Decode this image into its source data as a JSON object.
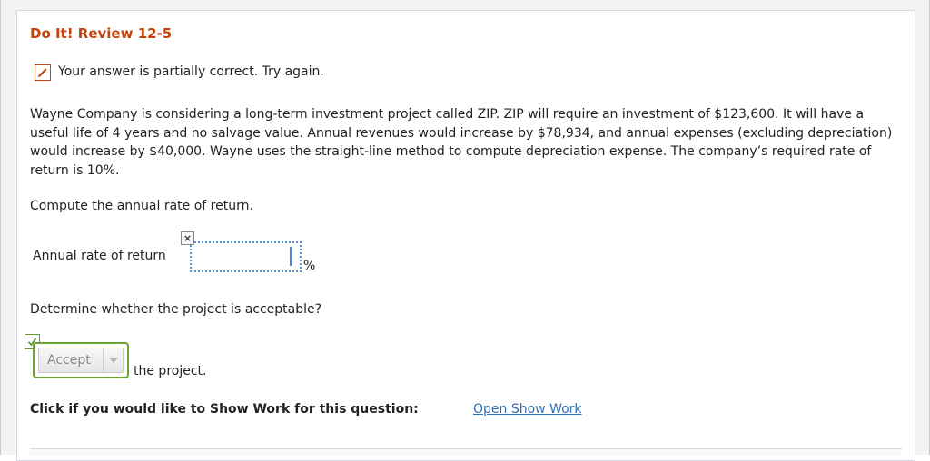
{
  "header": {
    "title": "Do It! Review 12-5"
  },
  "status": {
    "message": "Your answer is partially correct.  Try again.",
    "icon": "pencil-icon",
    "color": "#c0440c"
  },
  "problem": {
    "text": "Wayne Company is considering a long-term investment project called ZIP. ZIP will require an investment of $123,600. It will have a useful life of 4 years and no salvage value. Annual revenues would increase by $78,934, and annual expenses (excluding depreciation) would increase by $40,000. Wayne uses the straight-line method to compute depreciation expense. The company’s required rate of return is 10%."
  },
  "question1": {
    "prompt": "Compute the annual rate of return.",
    "field_label": "Annual rate of return",
    "value": "",
    "unit": "%",
    "mark": "×"
  },
  "question2": {
    "prompt": "Determine whether the project is acceptable?",
    "selected": "Accept",
    "suffix": "the project.",
    "accent": "#6aa531"
  },
  "show_work": {
    "label": "Click if you would like to Show Work for this question:",
    "link": "Open Show Work",
    "link_color": "#2f6eb5"
  }
}
